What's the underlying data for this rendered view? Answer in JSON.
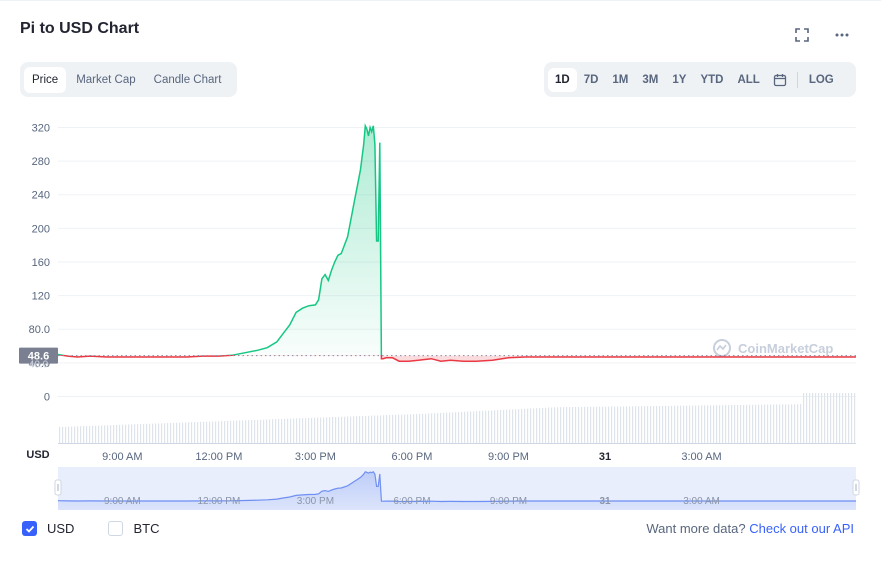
{
  "title": "Pi to USD Chart",
  "view_tabs": [
    "Price",
    "Market Cap",
    "Candle Chart"
  ],
  "range_tabs": [
    "1D",
    "7D",
    "1M",
    "3M",
    "1Y",
    "YTD",
    "ALL"
  ],
  "log_label": "LOG",
  "currency_label": "USD",
  "current_price_label": "48.6",
  "hidden_tick_label": "40.0",
  "watermark": "CoinMarketCap",
  "checkboxes": [
    {
      "label": "USD",
      "checked": true
    },
    {
      "label": "BTC",
      "checked": false
    }
  ],
  "footer": {
    "prefix": "Want more data?",
    "link": "Check out our API"
  },
  "colors": {
    "up": "#16c784",
    "down": "#ea3943",
    "accent": "#3861fb",
    "navigator": "#6f8ff2"
  },
  "chart_data": {
    "type": "line",
    "ylim": [
      0,
      330
    ],
    "y_ticks": [
      "0",
      "40.0",
      "80.0",
      "120",
      "160",
      "200",
      "240",
      "280",
      "320"
    ],
    "x_ticks": [
      "9:00 AM",
      "12:00 PM",
      "3:00 PM",
      "6:00 PM",
      "9:00 PM",
      "31",
      "3:00 AM"
    ],
    "baseline": 48.6,
    "series": [
      {
        "x": [
          7.0,
          7.3,
          7.6,
          8.0,
          8.5,
          9.0,
          9.5,
          10.0,
          10.5,
          11.0,
          11.5,
          12.0,
          12.4,
          12.8,
          13.2,
          13.5,
          13.8,
          14.0,
          14.2,
          14.4,
          14.6,
          14.8,
          15.0,
          15.1,
          15.2,
          15.3,
          15.4,
          15.5,
          15.6,
          15.7,
          15.8,
          16.0,
          16.1,
          16.2,
          16.3,
          16.4,
          16.5,
          16.55,
          16.6,
          16.65,
          16.7,
          16.75,
          16.8,
          16.85,
          16.9,
          16.95,
          17.0,
          17.05,
          17.1,
          17.2,
          17.4,
          17.6,
          17.9,
          18.2,
          18.6,
          18.9,
          19.2,
          19.6,
          20.0,
          20.5,
          21.0,
          21.5,
          22.0,
          22.3,
          22.4,
          22.5,
          22.6,
          22.7,
          23.0,
          23.3,
          23.6,
          24.0,
          24.3,
          24.5,
          24.7,
          25.0,
          25.5,
          26.0,
          26.5,
          27.0,
          27.5,
          28.0,
          28.5,
          29.0,
          29.5,
          30.0,
          30.5,
          31.0,
          31.5,
          31.8
        ],
        "y": [
          50,
          48,
          47,
          48,
          47,
          47,
          47,
          47,
          47,
          47,
          48,
          48,
          49,
          52,
          55,
          58,
          65,
          75,
          85,
          100,
          105,
          108,
          109,
          115,
          140,
          145,
          138,
          150,
          160,
          168,
          170,
          190,
          210,
          230,
          250,
          270,
          300,
          322,
          318,
          310,
          320,
          315,
          322,
          300,
          185,
          185,
          302,
          45,
          45,
          46,
          46,
          42,
          42,
          43,
          45,
          42,
          43,
          42,
          42,
          43,
          46,
          47,
          47,
          47,
          47,
          47,
          47,
          47,
          47,
          47,
          47,
          47,
          47,
          47,
          47,
          47,
          47,
          47,
          47,
          47,
          47,
          47,
          47,
          47,
          47,
          47,
          47,
          47,
          47,
          47
        ]
      }
    ]
  }
}
